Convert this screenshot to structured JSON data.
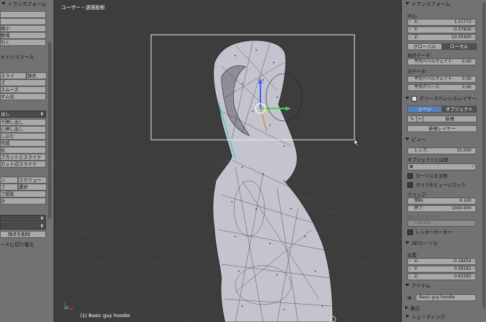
{
  "left_panel": {
    "header_transform": "トランスフォーム",
    "header_mesh_tools": "メッシュツール",
    "transform_buttons": [
      "",
      "縮小",
      "動場",
      "引く"
    ],
    "mesh_buttons": [
      "スライ",
      "ズ",
      "スムーズ",
      "ダム化"
    ],
    "mesh_right": "頂点",
    "extrude_select": "出し",
    "extrude_items": [
      "で押し出し",
      "に押し出し",
      "し込む",
      "作成",
      "化",
      "プカットとスライド",
      "カット辺スライド"
    ],
    "row2_left": "ン",
    "row2_right": "スクリュー",
    "row3_left": "フ",
    "row3_right": "選択",
    "row4": "フ投影",
    "row5": "計",
    "delete_vertex": "頂点を削除",
    "switch_mode": "ードに切り替え"
  },
  "viewport": {
    "title": "ユーザー・透視投影",
    "status": "(1) Basic guy hoodie"
  },
  "right_panel": {
    "transform_header": "トランスフォーム",
    "median_label": "中心:",
    "x_label": "X:",
    "x_value": "1.11773",
    "y_label": "Y:",
    "y_value": "-0.37856",
    "z_label": "Z:",
    "z_value": "10.35400",
    "global_label": "グローバル",
    "local_label": "ローカル",
    "vertex_data_label": "頂点データ:",
    "mean_bevel_weight_label": "平均ベベルウェイト:",
    "mean_bevel_weight_value": "0.00",
    "edge_data_label": "辺データ:",
    "edge_bevel_weight_label": "平均ベベルウェイト:",
    "edge_bevel_weight_value": "0.00",
    "mean_crease_label": "平均クリース:",
    "mean_crease_value": "0.00",
    "grease_pencil_header": "グリースペンシルレイヤー",
    "scene_label": "シーン",
    "object_label": "オブジェクト",
    "new_label": "新規",
    "new_layer_label": "新規レイヤー",
    "view_header": "ビュー",
    "lens_label": "レンズ:",
    "lens_value": "35.000",
    "lock_to_object_label": "オブジェクトには限",
    "lock_cursor_label": "カーソルを注視",
    "lock_camera_label": "カメラをビューにロック",
    "clip_label": "クリップ:",
    "clip_start_label": "開始:",
    "clip_start_value": "0.100",
    "clip_end_label": "終了:",
    "clip_end_value": "1000.000",
    "local_camera_label": "ローカルカメラ",
    "camera_label": "Camera",
    "render_border_label": "レンダーボーダー",
    "cursor_header": "3Dカーソル",
    "location_label": "位置:",
    "cx_label": "X:",
    "cx_value": "-0.18454",
    "cy_label": "Y:",
    "cy_value": "0.36181",
    "cz_label": "Z:",
    "cz_value": "0.65265",
    "item_header": "アイテム",
    "item_name": "Basic guy hoodie",
    "display_header": "表示",
    "shading_header": "シェーディング"
  },
  "colors": {
    "accent_blue": "#5680c2",
    "panel_gray": "#727272",
    "viewport_gray": "#3d3d3d",
    "field_gray": "#a9a9a9"
  }
}
